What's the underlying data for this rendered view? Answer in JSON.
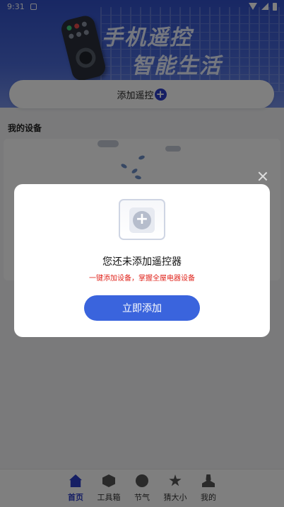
{
  "status_bar": {
    "time": "9:31"
  },
  "banner": {
    "line1": "手机遥控",
    "line2": "智能生活"
  },
  "add_bar": {
    "label": "添加遥控",
    "icon": "plus-circle-icon"
  },
  "section": {
    "title": "我的设备"
  },
  "dialog": {
    "title": "您还未添加遥控器",
    "subtitle": "一键添加设备，掌握全屋电器设备",
    "button_label": "立即添加"
  },
  "bottom_nav": {
    "items": [
      {
        "label": "首页",
        "icon": "home-icon",
        "active": true
      },
      {
        "label": "工具箱",
        "icon": "box-icon",
        "active": false
      },
      {
        "label": "节气",
        "icon": "weather-icon",
        "active": false
      },
      {
        "label": "猜大小",
        "icon": "star-icon",
        "active": false
      },
      {
        "label": "我的",
        "icon": "user-icon",
        "active": false
      }
    ]
  },
  "colors": {
    "accent": "#2d3fc8",
    "button": "#3a64dd",
    "warning_text": "#e0251d"
  }
}
